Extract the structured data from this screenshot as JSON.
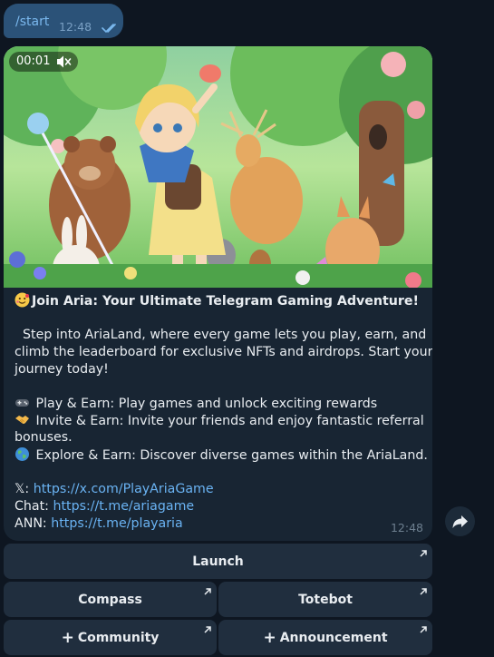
{
  "outgoing": {
    "text": "/start",
    "time": "12:48"
  },
  "video": {
    "time": "00:01",
    "muted": true
  },
  "message": {
    "headline_emoji": "smiling-face-with-hearts-emoji",
    "headline": "Join Aria: Your Ultimate Telegram Gaming Adventure!",
    "intro_lines": [
      "Step into AriaLand, where every game lets you play, earn, and",
      "climb the leaderboard for exclusive NFTs and airdrops. Start your",
      "journey today!"
    ],
    "features": [
      {
        "emoji": "gamepad-emoji",
        "line1": "Play & Earn: Play games and unlock exciting rewards",
        "line2": ""
      },
      {
        "emoji": "handshake-emoji",
        "line1": "Invite & Earn: Invite your friends and enjoy fantastic referral",
        "line2": "bonuses."
      },
      {
        "emoji": "globe-emoji",
        "line1": "Explore & Earn: Discover diverse games within the AriaLand.",
        "line2": ""
      }
    ],
    "links": [
      {
        "label": "𝕏: ",
        "url": "https://x.com/PlayAriaGame"
      },
      {
        "label": "Chat: ",
        "url": "https://t.me/ariagame"
      },
      {
        "label": "ANN: ",
        "url": "https://t.me/playaria"
      }
    ],
    "time": "12:48"
  },
  "keyboard": {
    "launch": "Launch",
    "compass": "Compass",
    "totebot": "Totebot",
    "community": "Community",
    "announcement": "Announcement",
    "plus": "+"
  },
  "colors": {
    "background": "#0e1621",
    "outgoing_bubble": "#2b5278",
    "incoming_bubble": "#182533",
    "link": "#6ab3f3",
    "keyboard_button": "#202e3e"
  }
}
